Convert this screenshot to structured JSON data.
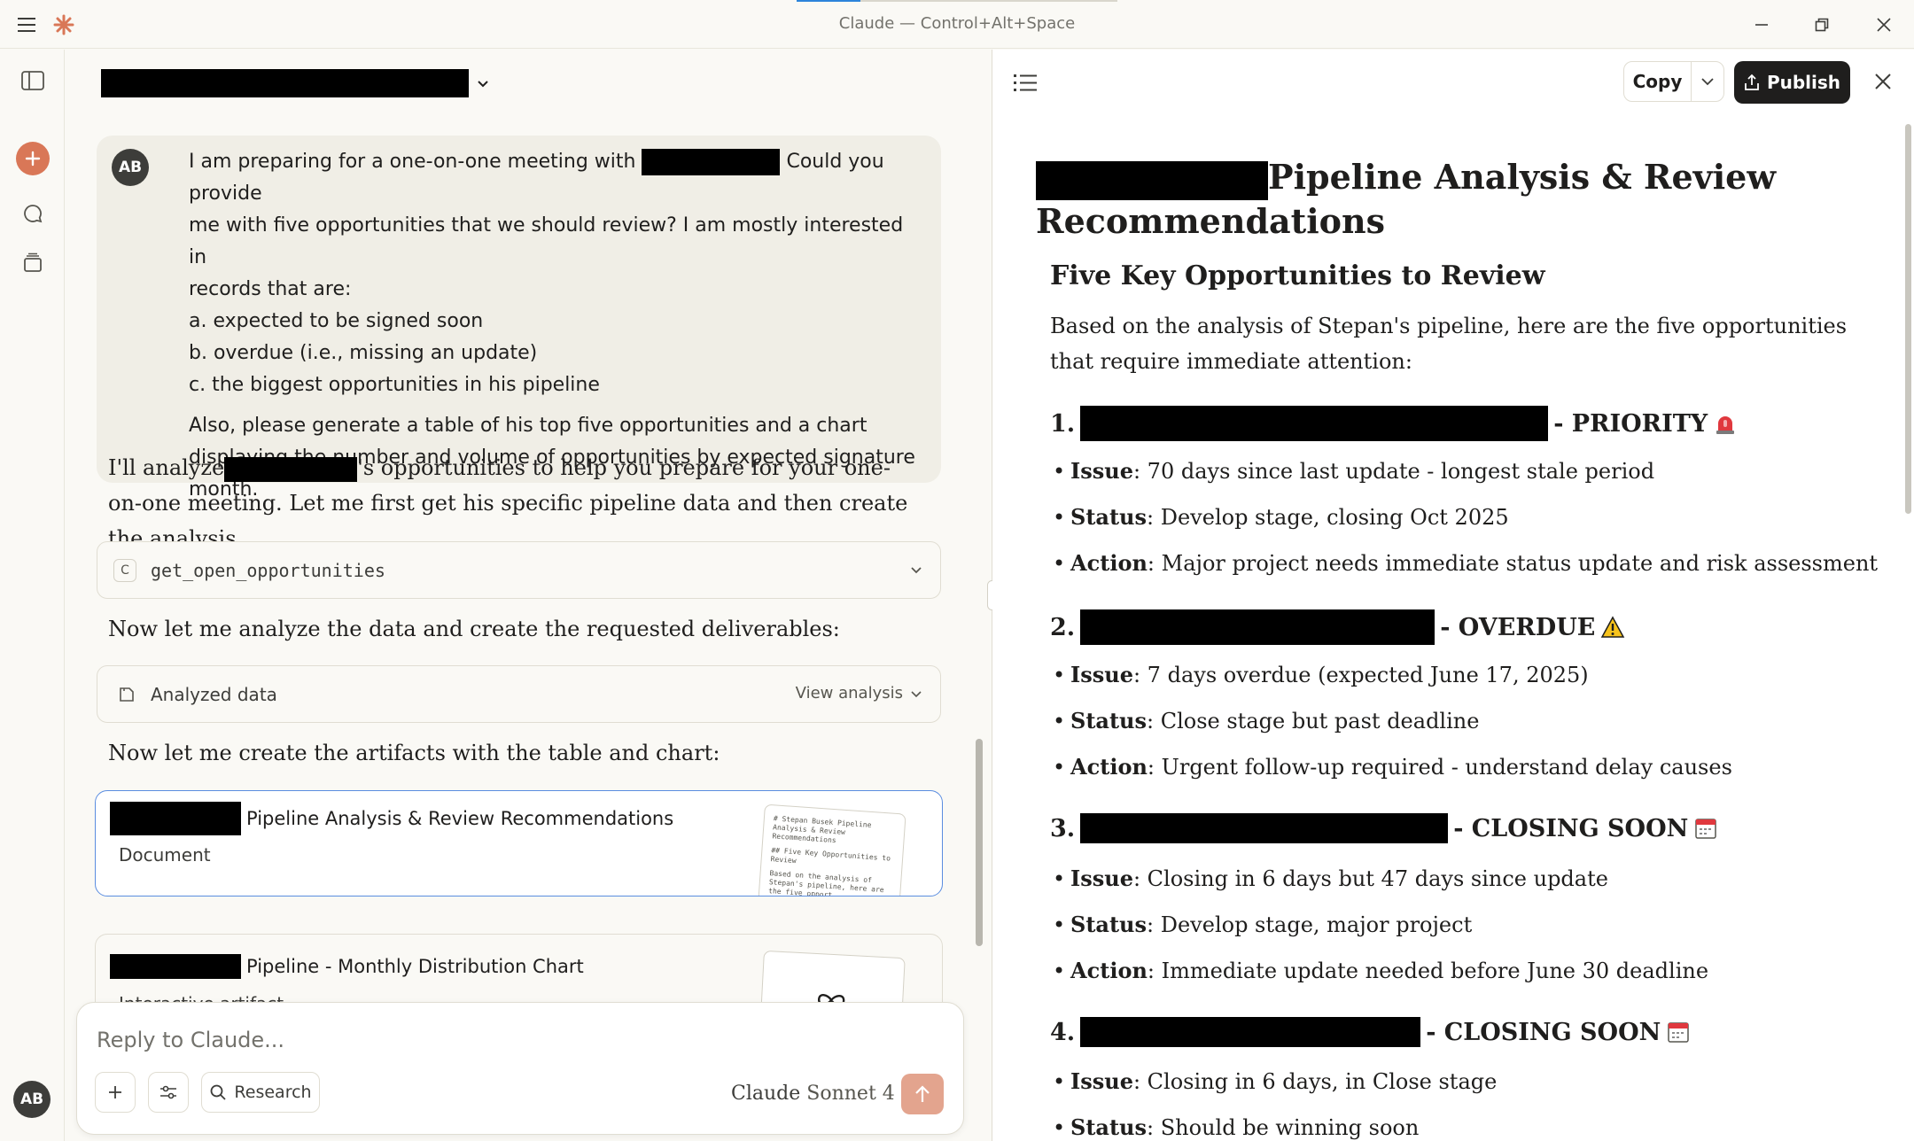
{
  "window": {
    "title": "Claude — Control+Alt+Space"
  },
  "rail": {
    "avatar": "AB"
  },
  "chat": {
    "user_message": {
      "avatar": "AB",
      "line1_a": "I am preparing for a one-on-one meeting with",
      "line1_b": "Could you provide",
      "line2": "me with five opportunities that we should review? I am mostly interested in",
      "line3": "records that are:",
      "item_a": "a. expected to be signed soon",
      "item_b": "b. overdue (i.e., missing an update)",
      "item_c": "c. the biggest opportunities in his pipeline",
      "para2": "Also, please generate a table of his top five opportunities and a chart displaying the number and volume of opportunities by expected signature month."
    },
    "assistant_intro_a": "I'll analyze",
    "assistant_intro_b": "'s opportunities to help you prepare for your one-on-one meeting. Let me first get his specific pipeline data and then create the analysis.",
    "tool_call": {
      "badge": "C",
      "name": "get_open_opportunities"
    },
    "assistant_2": "Now let me analyze the data and create the requested deliverables:",
    "analysis": {
      "label": "Analyzed data",
      "view_label": "View analysis"
    },
    "assistant_3": "Now let me create the artifacts with the table and chart:",
    "artifacts": [
      {
        "title": "Pipeline Analysis & Review Recommendations",
        "type": "Document",
        "thumb_line1": "# Stepan Busek Pipeline",
        "thumb_line2": "Analysis & Review",
        "thumb_line3": "Recommendations",
        "thumb_line4": "## Five Key Opportunities to",
        "thumb_line5": "Review",
        "thumb_line6": "Based on the analysis of",
        "thumb_line7": "Stepan's pipeline, here are",
        "thumb_line8": "the five opport..."
      },
      {
        "title": "Pipeline - Monthly Distribution Chart",
        "type": "Interactive artifact"
      }
    ],
    "composer": {
      "placeholder": "Reply to Claude...",
      "research_label": "Research",
      "model_prefix": "Claude",
      "model_name": "Sonnet 4"
    }
  },
  "panel": {
    "copy_label": "Copy",
    "publish_label": "Publish",
    "doc": {
      "title": "Pipeline Analysis & Review Recommendations",
      "h2": "Five Key Opportunities to Review",
      "intro": "Based on the analysis of Stepan's pipeline, here are the five opportunities that require immediate attention:",
      "opps": [
        {
          "num": "1.",
          "tag": "- PRIORITY",
          "emoji": "🚨",
          "bullets": [
            {
              "label": "Issue",
              "text": ": 70 days since last update - longest stale period"
            },
            {
              "label": "Status",
              "text": ": Develop stage, closing Oct 2025"
            },
            {
              "label": "Action",
              "text": ": Major project needs immediate status update and risk assessment"
            }
          ]
        },
        {
          "num": "2.",
          "tag": "- OVERDUE",
          "emoji": "⚠️",
          "bullets": [
            {
              "label": "Issue",
              "text": ": 7 days overdue (expected June 17, 2025)"
            },
            {
              "label": "Status",
              "text": ": Close stage but past deadline"
            },
            {
              "label": "Action",
              "text": ": Urgent follow-up required - understand delay causes"
            }
          ]
        },
        {
          "num": "3.",
          "tag": "- CLOSING SOON",
          "emoji": "📅",
          "bullets": [
            {
              "label": "Issue",
              "text": ": Closing in 6 days but 47 days since update"
            },
            {
              "label": "Status",
              "text": ": Develop stage, major project"
            },
            {
              "label": "Action",
              "text": ": Immediate update needed before June 30 deadline"
            }
          ]
        },
        {
          "num": "4.",
          "tag": "- CLOSING SOON",
          "emoji": "📅",
          "bullets": [
            {
              "label": "Issue",
              "text": ": Closing in 6 days, in Close stage"
            },
            {
              "label": "Status",
              "text": ": Should be winning soon"
            }
          ]
        }
      ]
    }
  }
}
